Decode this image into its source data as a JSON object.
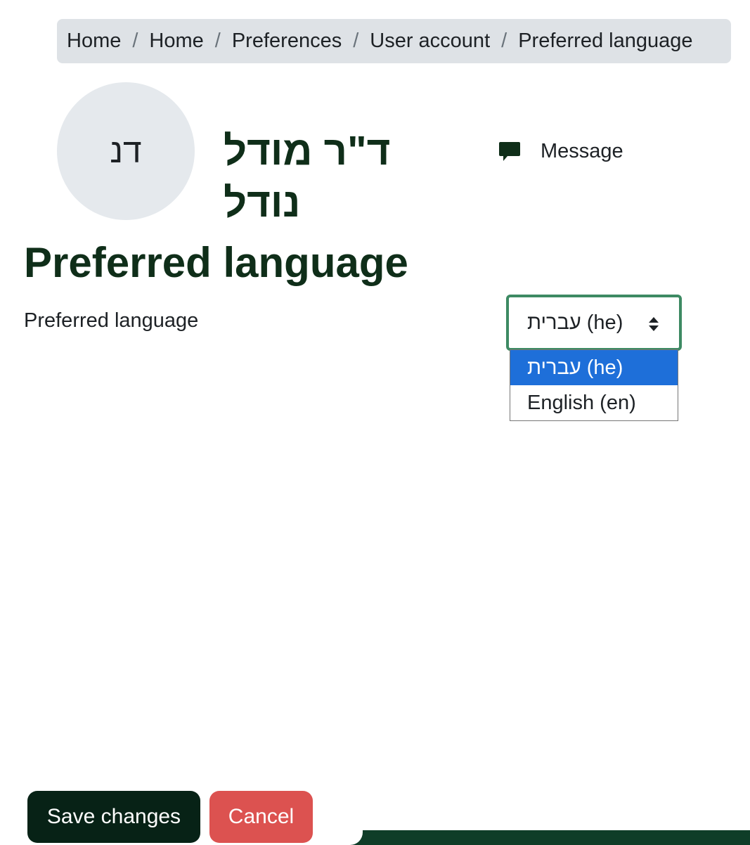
{
  "breadcrumb": [
    "Home",
    "Home",
    "Preferences",
    "User account",
    "Preferred language"
  ],
  "breadcrumb_separator": "/",
  "user": {
    "initials": "דנ",
    "full_name": "ד\"ר מודל נודל",
    "message_label": "Message"
  },
  "page_title": "Preferred language",
  "field": {
    "label": "Preferred language",
    "selected_value": "עברית (he)",
    "options": [
      "עברית (he)",
      "English (en)"
    ]
  },
  "buttons": {
    "save": "Save changes",
    "cancel": "Cancel"
  },
  "colors": {
    "brand_dark": "#0f2e19",
    "breadcrumb_bg": "#dee2e6",
    "select_focus": "#3d8a63",
    "option_highlight": "#1e6fd9",
    "cancel": "#dc5250"
  },
  "icons": {
    "message": "speech-bubble-icon",
    "select_arrows": "sort-arrows-icon"
  }
}
